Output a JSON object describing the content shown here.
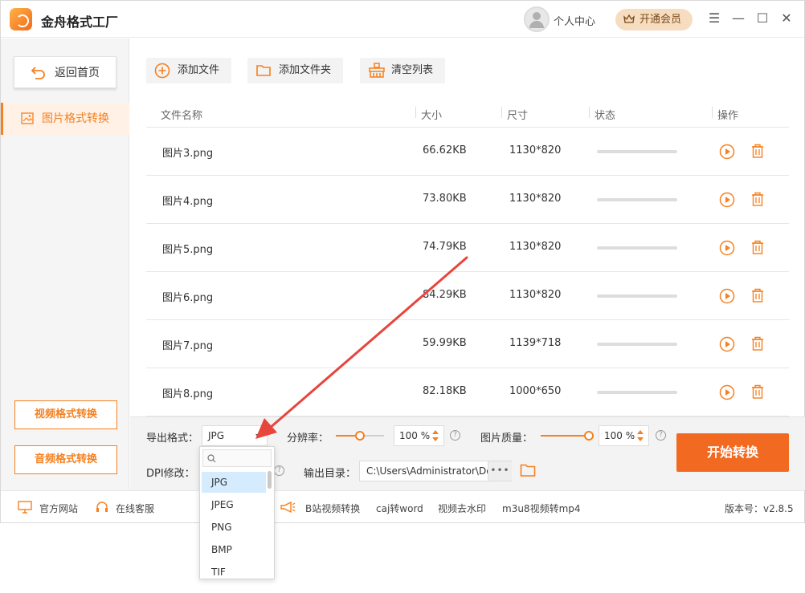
{
  "titlebar": {
    "app_title": "金舟格式工厂",
    "user_center": "个人中心",
    "vip_label": "开通会员",
    "menu_glyph": "☰",
    "minimize_glyph": "—",
    "maximize_glyph": "☐",
    "close_glyph": "✕"
  },
  "sidebar": {
    "home_label": "返回首页",
    "active_item": "图片格式转换",
    "video_label": "视频格式转换",
    "audio_label": "音频格式转换"
  },
  "toolbar": {
    "add_file": "添加文件",
    "add_folder": "添加文件夹",
    "clear_list": "清空列表"
  },
  "table": {
    "headers": [
      "文件名称",
      "大小",
      "尺寸",
      "状态",
      "操作"
    ],
    "rows": [
      {
        "name": "图片3.png",
        "size": "66.62KB",
        "dims": "1130*820",
        "progress": 0
      },
      {
        "name": "图片4.png",
        "size": "73.80KB",
        "dims": "1130*820",
        "progress": 0
      },
      {
        "name": "图片5.png",
        "size": "74.79KB",
        "dims": "1130*820",
        "progress": 0
      },
      {
        "name": "图片6.png",
        "size": "84.29KB",
        "dims": "1130*820",
        "progress": 0
      },
      {
        "name": "图片7.png",
        "size": "59.99KB",
        "dims": "1139*718",
        "progress": 0
      },
      {
        "name": "图片8.png",
        "size": "82.18KB",
        "dims": "1000*650",
        "progress": 0
      }
    ]
  },
  "settings": {
    "format_label": "导出格式：",
    "format_value": "JPG",
    "resolution_label": "分辨率：",
    "resolution_value": "100 %",
    "resolution_level": 0.5,
    "quality_label": "图片质量：",
    "quality_value": "100 %",
    "quality_level": 1.0,
    "dpi_label": "DPI修改：",
    "output_label": "输出目录：",
    "output_path": "C:\\Users\\Administrator\\De",
    "browse_glyph": "•••",
    "help_glyph": "?",
    "start_label": "开始转换"
  },
  "dropdown": {
    "options": [
      "JPG",
      "JPEG",
      "PNG",
      "BMP",
      "TIF"
    ],
    "selected": "JPG"
  },
  "footer": {
    "website": "官方网站",
    "support": "在线客服",
    "links": [
      "B站视频转换",
      "caj转word",
      "视频去水印",
      "m3u8视频转mp4"
    ],
    "version": "版本号：v2.8.5"
  },
  "colors": {
    "accent": "#f5801f",
    "start_button": "#f26a22",
    "arrow": "#e8453c"
  }
}
